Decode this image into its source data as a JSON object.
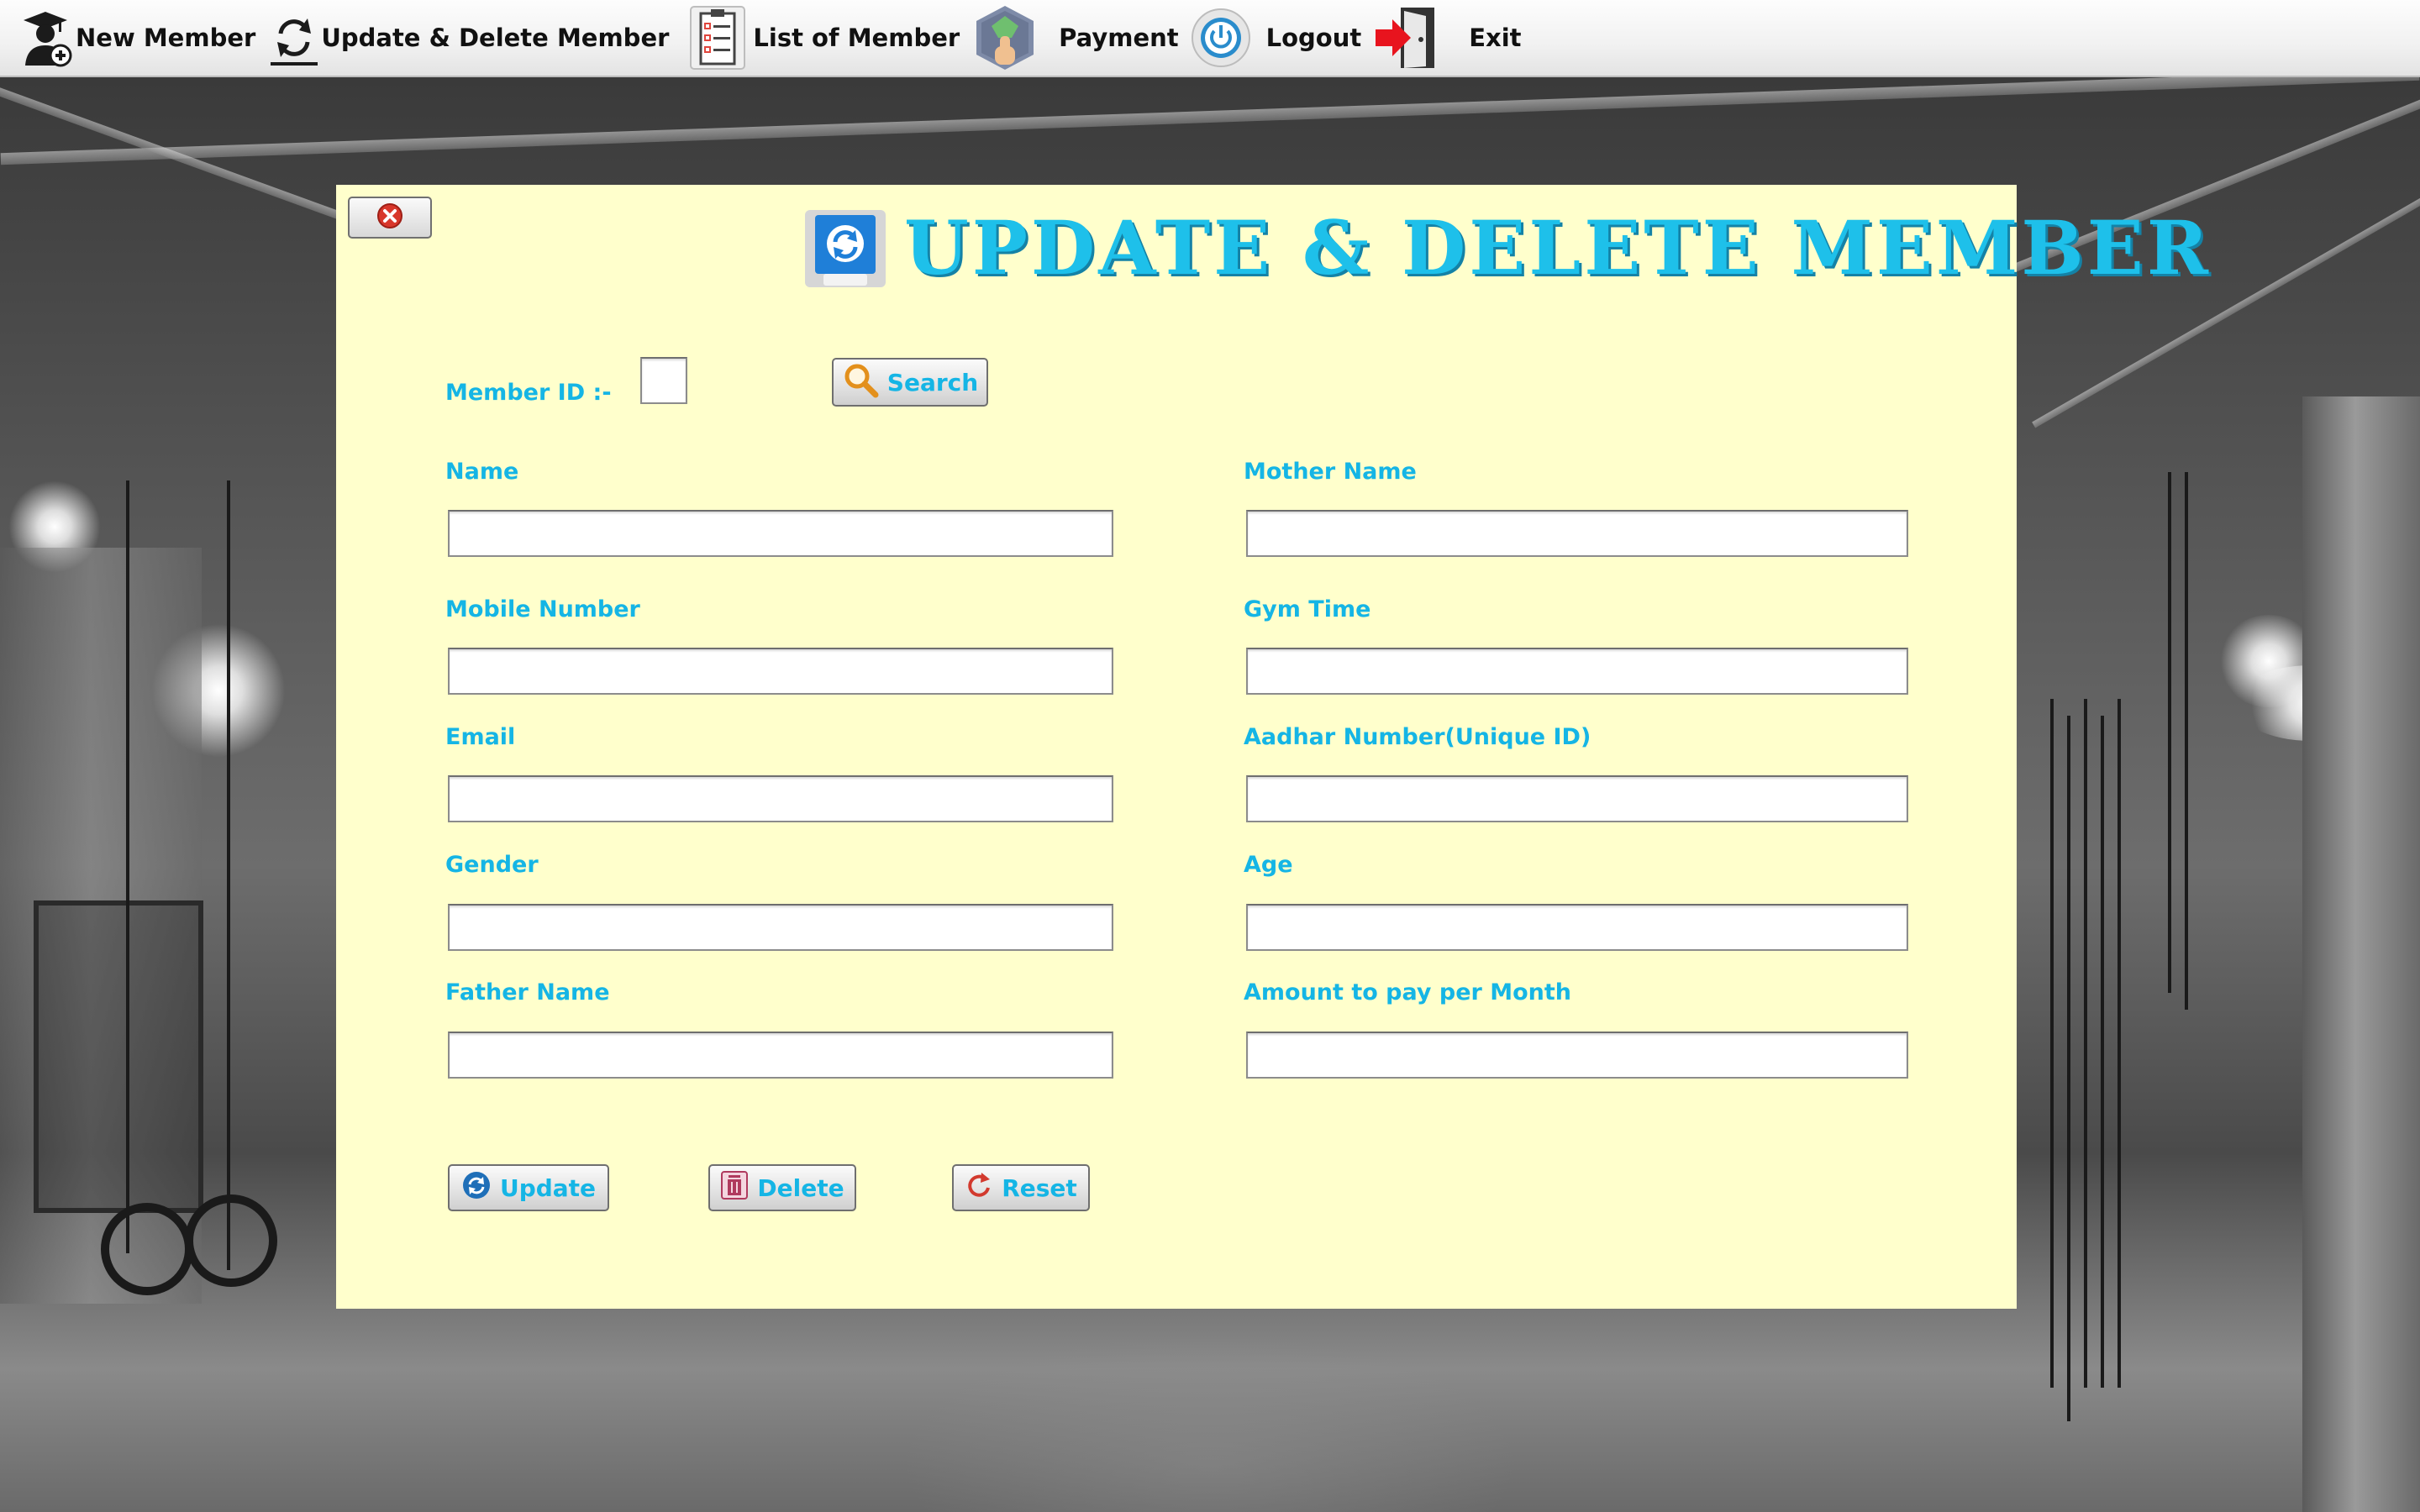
{
  "toolbar": {
    "items": [
      {
        "label": "New Member",
        "icon": "add-member-icon"
      },
      {
        "label": "Update & Delete Member",
        "icon": "refresh-icon"
      },
      {
        "label": "List of Member",
        "icon": "clipboard-list-icon"
      },
      {
        "label": "Payment",
        "icon": "payment-icon"
      },
      {
        "label": "Logout",
        "icon": "power-icon"
      },
      {
        "label": "Exit",
        "icon": "exit-door-icon"
      }
    ]
  },
  "dialog": {
    "title": "UPDATE & DELETE MEMBER",
    "title_color": "#1ec0ea",
    "panel_color": "#ffffcc",
    "label_color": "#15b5e5",
    "member_id_label": "Member ID :-",
    "member_id_value": "",
    "search_label": "Search",
    "fields": {
      "name": {
        "label": "Name",
        "value": ""
      },
      "mother_name": {
        "label": "Mother Name",
        "value": ""
      },
      "mobile_number": {
        "label": "Mobile Number",
        "value": ""
      },
      "gym_time": {
        "label": "Gym Time",
        "value": ""
      },
      "email": {
        "label": "Email",
        "value": ""
      },
      "aadhar_number": {
        "label": "Aadhar Number(Unique ID)",
        "value": ""
      },
      "gender": {
        "label": "Gender",
        "value": ""
      },
      "age": {
        "label": "Age",
        "value": ""
      },
      "father_name": {
        "label": "Father Name",
        "value": ""
      },
      "amount_per_month": {
        "label": "Amount to pay per Month",
        "value": ""
      }
    },
    "buttons": {
      "update": "Update",
      "delete": "Delete",
      "reset": "Reset"
    }
  }
}
